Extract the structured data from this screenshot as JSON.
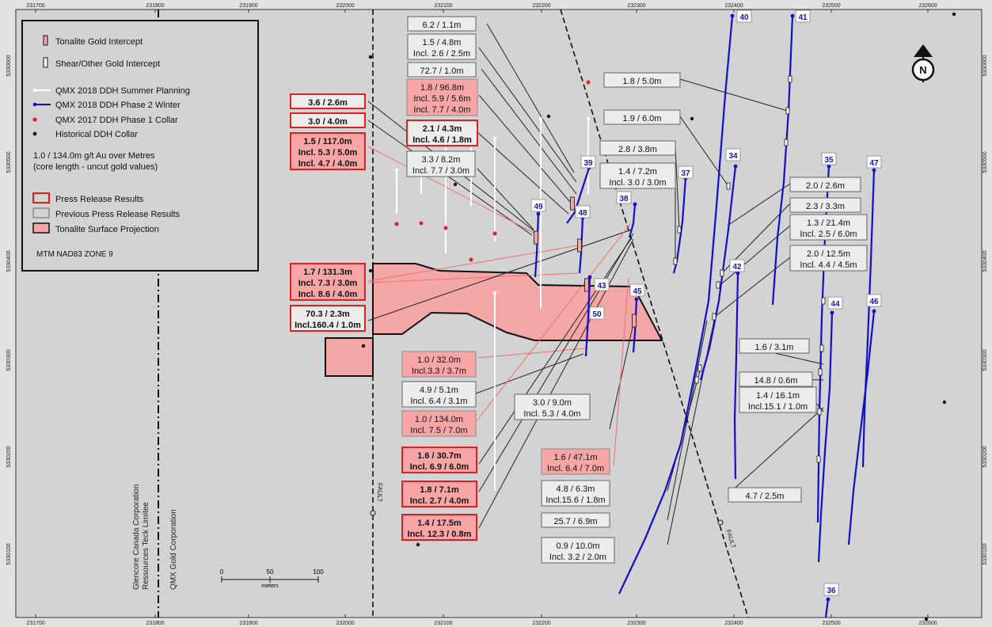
{
  "colors": {
    "map_bg": "#d3d3d3",
    "frame": "#e2e2e2",
    "new_result_border": "#e02020",
    "new_result_fill": "#f7a5a5",
    "prev_result_fill": "#ececec",
    "winter_drill": "#1010cc",
    "summer_drill": "#ffffff",
    "collar_red": "#e02020",
    "tonalite_fill": "#f4a7a7",
    "leader_black": "#222222",
    "leader_red": "#f07070"
  },
  "grid": {
    "eastings": [
      "231700",
      "231800",
      "231900",
      "232000",
      "232100",
      "232200",
      "232300",
      "232400",
      "232500",
      "232600"
    ],
    "northings": [
      "5330600",
      "5330500",
      "5330400",
      "5330300",
      "5330200",
      "5330100"
    ]
  },
  "legend": {
    "items": [
      {
        "icon": "tonalite-intercept-icon",
        "label": "Tonalite Gold Intercept"
      },
      {
        "icon": "shear-intercept-icon",
        "label": "Shear/Other Gold Intercept"
      },
      {
        "icon": "summer-ddh-icon",
        "label": "QMX 2018 DDH Summer Planning"
      },
      {
        "icon": "winter-ddh-icon",
        "label": "QMX 2018 DDH Phase 2 Winter"
      },
      {
        "icon": "red-collar-icon",
        "label": "QMX 2017 DDH Phase 1 Collar"
      },
      {
        "icon": "black-collar-icon",
        "label": "Historical DDH Collar"
      }
    ],
    "note_line1": "1.0 / 134.0m g/t Au over Metres",
    "note_line2": "(core length - uncut gold values)",
    "box_items": [
      {
        "icon": "press-release-box-icon",
        "label": "Press Release Results"
      },
      {
        "icon": "previous-release-box-icon",
        "label": "Previous Press Release Results"
      },
      {
        "icon": "tonalite-projection-icon",
        "label": "Tonalite Surface Projection"
      }
    ],
    "projection": "MTM NAD83 ZONE 9"
  },
  "boundary_labels": {
    "glencore_line1": "Glencore Canada Corporation",
    "glencore_line2": "Ressources Teck Limitee",
    "qmx": "QMX Gold Corporation"
  },
  "fault_label": "FAULT",
  "scale_bar": {
    "ticks": [
      "0",
      "50",
      "100"
    ],
    "unit": "meters"
  },
  "north_arrow": "N",
  "drill_labels": [
    "40",
    "41",
    "34",
    "35",
    "47",
    "39",
    "37",
    "38",
    "49",
    "48",
    "43",
    "45",
    "50",
    "42",
    "44",
    "46",
    "36"
  ],
  "results": {
    "new": [
      [
        "3.6 / 2.6m"
      ],
      [
        "3.0 / 4.0m"
      ],
      [
        "1.5 / 117.0m",
        "Incl. 5.3 / 5.0m",
        "Incl. 4.7 / 4.0m"
      ],
      [
        "2.1 / 4.3m",
        "Incl. 4.6 / 1.8m"
      ],
      [
        "1.7 / 131.3m",
        "Incl. 7.3 / 3.0m",
        "Incl. 8.6 / 4.0m"
      ],
      [
        "70.3 / 2.3m",
        "Incl.160.4 / 1.0m"
      ],
      [
        "1.6 / 30.7m",
        "Incl. 6.9 / 6.0m"
      ],
      [
        "1.8 / 7.1m",
        "Incl. 2.7 / 4.0m"
      ],
      [
        "1.4 / 17.5m",
        "Incl. 12.3 / 0.8m"
      ]
    ],
    "tonalite_previous": [
      [
        "1.8 / 96.8m",
        "Incl. 5.9 / 5.6m",
        "Incl. 7.7 / 4.0m"
      ],
      [
        "1.0 / 32.0m",
        "Incl.3.3 / 3.7m"
      ],
      [
        "1.0 / 134.0m",
        "Incl. 7.5 / 7.0m"
      ],
      [
        "1.6 / 47.1m",
        "Incl. 6.4 / 7.0m"
      ]
    ],
    "previous": [
      [
        "6.2 / 1.1m"
      ],
      [
        "1.5 / 4.8m",
        "Incl. 2.6 / 2.5m"
      ],
      [
        "72.7 / 1.0m"
      ],
      [
        "3.3 / 8.2m",
        "Incl. 7.7 / 3.0m"
      ],
      [
        "1.8 / 5.0m"
      ],
      [
        "1.9 / 6.0m"
      ],
      [
        "2.8 / 3.8m"
      ],
      [
        "1.4 / 7.2m",
        "Incl. 3.0 / 3.0m"
      ],
      [
        "2.0 / 2.6m"
      ],
      [
        "2.3 / 3.3m"
      ],
      [
        "1.3 / 21.4m",
        "Incl. 2.5 / 6.0m"
      ],
      [
        "2.0 / 12.5m",
        "Incl. 4.4 / 4.5m"
      ],
      [
        "4.9 / 5.1m",
        "Incl. 6.4 / 3.1m"
      ],
      [
        "3.0 / 9.0m",
        "Incl. 5.3 / 4.0m"
      ],
      [
        "1.6 / 3.1m"
      ],
      [
        "14.8 / 0.6m"
      ],
      [
        "1.4 / 16.1m",
        "Incl.15.1 / 1.0m"
      ],
      [
        "4.7 / 2.5m"
      ],
      [
        "4.8 / 6.3m",
        "Incl.15.6 / 1.8m"
      ],
      [
        "25.7 / 6.9m"
      ],
      [
        "0.9 / 10.0m",
        "Incl. 3.2 / 2.0m"
      ]
    ]
  }
}
